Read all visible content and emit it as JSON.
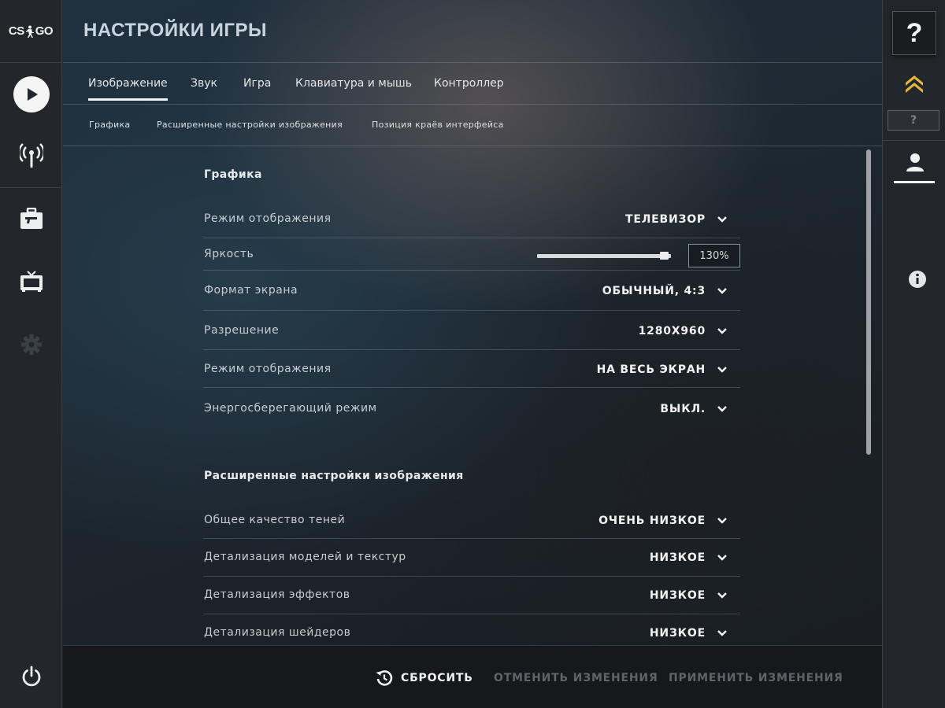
{
  "app": {
    "logo_text_left": "CS",
    "logo_text_right": "GO"
  },
  "left_nav": {
    "items": [
      {
        "name": "play-icon"
      },
      {
        "name": "broadcast-icon"
      },
      {
        "name": "inventory-icon"
      },
      {
        "name": "tv-icon"
      },
      {
        "name": "gear-icon"
      },
      {
        "name": "power-icon"
      }
    ]
  },
  "header": {
    "title": "НАСТРОЙКИ ИГРЫ"
  },
  "tabs": [
    {
      "label": "Изображение",
      "active": true
    },
    {
      "label": "Звук",
      "active": false
    },
    {
      "label": "Игра",
      "active": false
    },
    {
      "label": "Клавиатура и мышь",
      "active": false
    },
    {
      "label": "Контроллер",
      "active": false
    }
  ],
  "subtabs": [
    {
      "label": "Графика"
    },
    {
      "label": "Расширенные настройки изображения"
    },
    {
      "label": "Позиция краёв интерфейса"
    }
  ],
  "sections": {
    "graphics": {
      "title": "Графика",
      "rows": [
        {
          "label": "Режим отображения",
          "value": "ТЕЛЕВИЗОР"
        },
        {
          "label": "Яркость",
          "slider_value": "130%",
          "slider_fraction": 0.95
        },
        {
          "label": "Формат экрана",
          "value": "ОБЫЧНЫЙ, 4:3"
        },
        {
          "label": "Разрешение",
          "value": "1280X960"
        },
        {
          "label": "Режим отображения",
          "value": "НА ВЕСЬ ЭКРАН"
        },
        {
          "label": "Энергосберегающий режим",
          "value": "ВЫКЛ."
        }
      ]
    },
    "advanced": {
      "title": "Расширенные настройки изображения",
      "rows": [
        {
          "label": "Общее качество теней",
          "value": "ОЧЕНЬ НИЗКОЕ"
        },
        {
          "label": "Детализация моделей и текстур",
          "value": "НИЗКОЕ"
        },
        {
          "label": "Детализация эффектов",
          "value": "НИЗКОЕ"
        },
        {
          "label": "Детализация шейдеров",
          "value": "НИЗКОЕ"
        }
      ]
    }
  },
  "footer": {
    "reset_label": "СБРОСИТЬ",
    "cancel_label": "ОТМЕНИТЬ ИЗМЕНЕНИЯ",
    "apply_label": "ПРИМЕНИТЬ ИЗМЕНЕНИЯ"
  },
  "right_nav": {
    "help_label": "?",
    "rank_label": "?"
  },
  "colors": {
    "sidebar_bg": "#23272b",
    "text_primary": "#f2f2f2",
    "text_disabled": "#5f6469",
    "rank_gold": "#e6b63c"
  }
}
